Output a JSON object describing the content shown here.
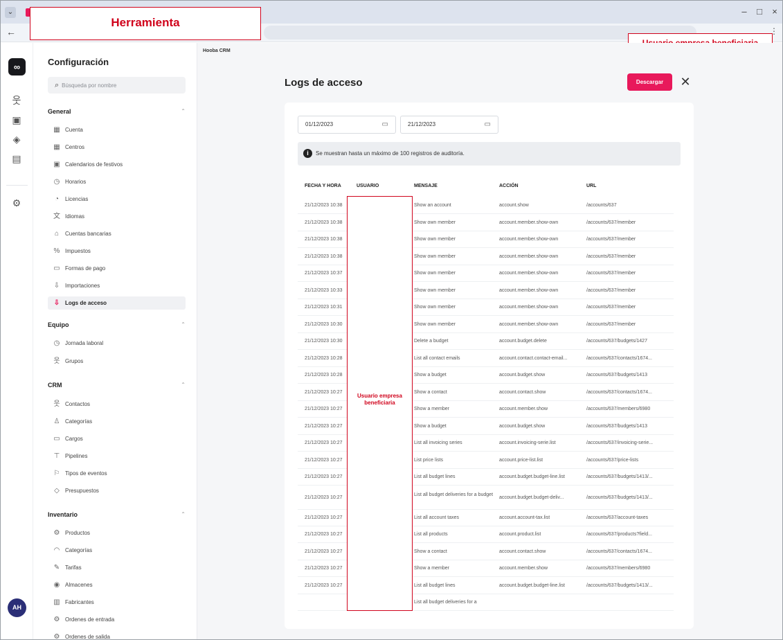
{
  "annotations": {
    "tool": "Herramienta",
    "user_top": "Usuario empresa beneficiaria",
    "user_column": "Usuario empresa beneficiaria"
  },
  "rail": {
    "logo": "∞",
    "avatar": "AH",
    "icons": [
      "contacts-icon",
      "person-card-icon",
      "box-icon",
      "document-icon",
      "settings-icon"
    ]
  },
  "sidebar": {
    "title": "Configuración",
    "search_placeholder": "Búsqueda por nombre",
    "sections": [
      {
        "label": "General",
        "items": [
          {
            "label": "Cuenta",
            "icon": "account-icon"
          },
          {
            "label": "Centros",
            "icon": "building-icon"
          },
          {
            "label": "Calendarios de festivos",
            "icon": "calendar-icon"
          },
          {
            "label": "Horarios",
            "icon": "clock-icon"
          },
          {
            "label": "Licencias",
            "icon": "license-icon"
          },
          {
            "label": "Idiomas",
            "icon": "language-icon"
          },
          {
            "label": "Cuentas bancarias",
            "icon": "bank-icon"
          },
          {
            "label": "Impuestos",
            "icon": "percent-icon"
          },
          {
            "label": "Formas de pago",
            "icon": "card-icon"
          },
          {
            "label": "Importaciones",
            "icon": "import-icon"
          },
          {
            "label": "Logs de acceso",
            "icon": "log-icon",
            "active": true
          }
        ]
      },
      {
        "label": "Equipo",
        "items": [
          {
            "label": "Jornada laboral",
            "icon": "clock-icon"
          },
          {
            "label": "Grupos",
            "icon": "group-icon"
          }
        ]
      },
      {
        "label": "CRM",
        "items": [
          {
            "label": "Contactos",
            "icon": "contacts-icon"
          },
          {
            "label": "Categorías",
            "icon": "user-icon"
          },
          {
            "label": "Cargos",
            "icon": "briefcase-icon"
          },
          {
            "label": "Pipelines",
            "icon": "pipeline-icon"
          },
          {
            "label": "Tipos de eventos",
            "icon": "flag-icon"
          },
          {
            "label": "Presupuestos",
            "icon": "budget-icon"
          }
        ]
      },
      {
        "label": "Inventario",
        "items": [
          {
            "label": "Productos",
            "icon": "product-icon"
          },
          {
            "label": "Categorías",
            "icon": "tag-icon"
          },
          {
            "label": "Tarifas",
            "icon": "tariff-icon"
          },
          {
            "label": "Almacenes",
            "icon": "warehouse-icon"
          },
          {
            "label": "Fabricantes",
            "icon": "factory-icon"
          },
          {
            "label": "Ordenes de entrada",
            "icon": "inbound-icon"
          },
          {
            "label": "Ordenes de salida",
            "icon": "outbound-icon"
          }
        ]
      }
    ]
  },
  "main": {
    "breadcrumb": "Hooba CRM",
    "title": "Logs de acceso",
    "download_label": "Descargar",
    "date_from": "01/12/2023",
    "date_to": "21/12/2023",
    "info_text": "Se muestran hasta un máximo de 100 registros de auditoría.",
    "columns": [
      "FECHA Y HORA",
      "USUARIO",
      "MENSAJE",
      "ACCIÓN",
      "URL"
    ],
    "rows": [
      {
        "date": "21/12/2023 10:38",
        "message": "Show an account",
        "action": "account.show",
        "url": "/accounts/637"
      },
      {
        "date": "21/12/2023 10:38",
        "message": "Show own member",
        "action": "account.member.show-own",
        "url": "/accounts/637/member"
      },
      {
        "date": "21/12/2023 10:38",
        "message": "Show own member",
        "action": "account.member.show-own",
        "url": "/accounts/637/member"
      },
      {
        "date": "21/12/2023 10:38",
        "message": "Show own member",
        "action": "account.member.show-own",
        "url": "/accounts/637/member"
      },
      {
        "date": "21/12/2023 10:37",
        "message": "Show own member",
        "action": "account.member.show-own",
        "url": "/accounts/637/member"
      },
      {
        "date": "21/12/2023 10:33",
        "message": "Show own member",
        "action": "account.member.show-own",
        "url": "/accounts/637/member"
      },
      {
        "date": "21/12/2023 10:31",
        "message": "Show own member",
        "action": "account.member.show-own",
        "url": "/accounts/637/member"
      },
      {
        "date": "21/12/2023 10:30",
        "message": "Show own member",
        "action": "account.member.show-own",
        "url": "/accounts/637/member"
      },
      {
        "date": "21/12/2023 10:30",
        "message": "Delete a budget",
        "action": "account.budget.delete",
        "url": "/accounts/637/budgets/1427"
      },
      {
        "date": "21/12/2023 10:28",
        "message": "List all contact emails",
        "action": "account.contact.contact-email...",
        "url": "/accounts/637/contacts/1674..."
      },
      {
        "date": "21/12/2023 10:28",
        "message": "Show a budget",
        "action": "account.budget.show",
        "url": "/accounts/637/budgets/1413"
      },
      {
        "date": "21/12/2023 10:27",
        "message": "Show a contact",
        "action": "account.contact.show",
        "url": "/accounts/637/contacts/1674..."
      },
      {
        "date": "21/12/2023 10:27",
        "message": "Show a member",
        "action": "account.member.show",
        "url": "/accounts/637/members/6980"
      },
      {
        "date": "21/12/2023 10:27",
        "message": "Show a budget",
        "action": "account.budget.show",
        "url": "/accounts/637/budgets/1413"
      },
      {
        "date": "21/12/2023 10:27",
        "message": "List all invoicing series",
        "action": "account.invoicing-serie.list",
        "url": "/accounts/637/invoicing-serie..."
      },
      {
        "date": "21/12/2023 10:27",
        "message": "List price lists",
        "action": "account.price-list.list",
        "url": "/accounts/637/price-lists"
      },
      {
        "date": "21/12/2023 10:27",
        "message": "List all budget lines",
        "action": "account.budget.budget-line.list",
        "url": "/accounts/637/budgets/1413/..."
      },
      {
        "date": "21/12/2023 10:27",
        "message": "List all budget deliveries for a budget",
        "action": "account.budget.budget-deliv...",
        "url": "/accounts/637/budgets/1413/...",
        "tall": true
      },
      {
        "date": "21/12/2023 10:27",
        "message": "List all account taxes",
        "action": "account.account-tax.list",
        "url": "/accounts/637/account-taxes"
      },
      {
        "date": "21/12/2023 10:27",
        "message": "List all products",
        "action": "account.product.list",
        "url": "/accounts/637/products?field..."
      },
      {
        "date": "21/12/2023 10:27",
        "message": "Show a contact",
        "action": "account.contact.show",
        "url": "/accounts/637/contacts/1674..."
      },
      {
        "date": "21/12/2023 10:27",
        "message": "Show a member",
        "action": "account.member.show",
        "url": "/accounts/637/members/6980"
      },
      {
        "date": "21/12/2023 10:27",
        "message": "List all budget lines",
        "action": "account.budget.budget-line.list",
        "url": "/accounts/637/budgets/1413/..."
      },
      {
        "date": "",
        "message": "List all budget deliveries for a",
        "action": "",
        "url": ""
      }
    ]
  }
}
